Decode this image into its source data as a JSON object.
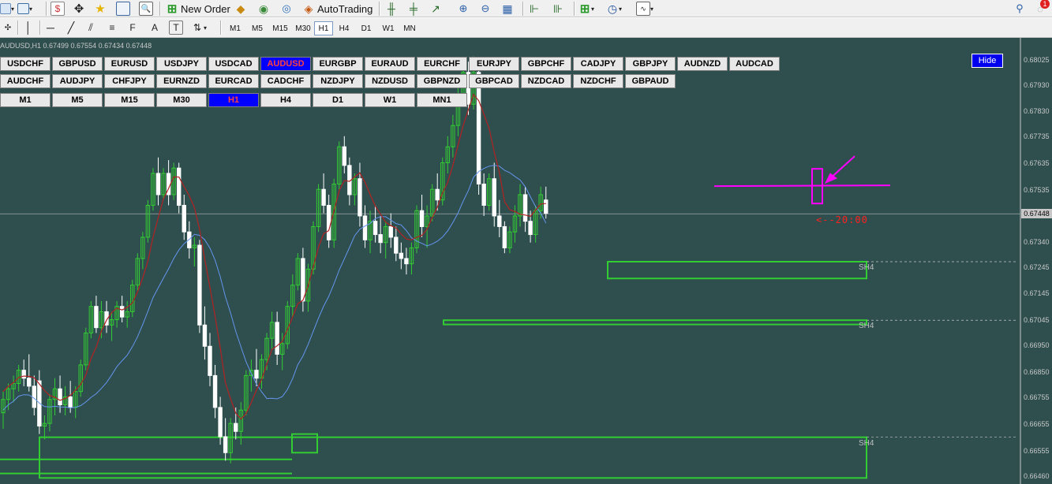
{
  "toolbar": {
    "new_order_label": "New Order",
    "autotrading_label": "AutoTrading",
    "timeframes": [
      "M1",
      "M5",
      "M15",
      "M30",
      "H1",
      "H4",
      "D1",
      "W1",
      "MN"
    ],
    "active_timeframe": "H1",
    "notification_count": "1"
  },
  "chart": {
    "title": "AUDUSD,H1  0.67499 0.67554 0.67434 0.67448",
    "current_price": "0.67448",
    "price_labels": [
      "0.68025",
      "0.67930",
      "0.67830",
      "0.67735",
      "0.67635",
      "0.67535",
      "0.67440",
      "0.67340",
      "0.67245",
      "0.67145",
      "0.67045",
      "0.66950",
      "0.66850",
      "0.66755",
      "0.66655",
      "0.66555",
      "0.66460"
    ],
    "annotation": "<--20:00",
    "zone_labels": [
      "SH4",
      "SH4",
      "SH4"
    ],
    "colors": {
      "background": "#2f4f4f",
      "bull_candle": "#32cd32",
      "bear_candle": "#ffffff",
      "ma_red": "#b22222",
      "ma_blue": "#6495ed",
      "zone": "#32cd32",
      "marker": "#ff00ff"
    }
  },
  "symbols": {
    "row1": [
      "USDCHF",
      "GBPUSD",
      "EURUSD",
      "USDJPY",
      "USDCAD",
      "AUDUSD",
      "EURGBP",
      "EURAUD",
      "EURCHF",
      "EURJPY",
      "GBPCHF",
      "CADJPY",
      "GBPJPY",
      "AUDNZD",
      "AUDCAD"
    ],
    "row2": [
      "AUDCHF",
      "AUDJPY",
      "CHFJPY",
      "EURNZD",
      "EURCAD",
      "CADCHF",
      "NZDJPY",
      "NZDUSD",
      "GBPNZD",
      "GBPCAD",
      "NZDCAD",
      "NZDCHF",
      "GBPAUD"
    ],
    "row3": [
      "M1",
      "M5",
      "M15",
      "M30",
      "H1",
      "H4",
      "D1",
      "W1",
      "MN1"
    ],
    "active_symbol": "AUDUSD",
    "active_tf": "H1"
  },
  "hide_label": "Hide",
  "chart_data": {
    "type": "candlestick",
    "symbol": "AUDUSD",
    "timeframe": "H1",
    "ylim": [
      0.6645,
      0.6808
    ],
    "candles": [
      [
        0.667,
        0.6678,
        0.6664,
        0.6675
      ],
      [
        0.6675,
        0.6681,
        0.6671,
        0.6679
      ],
      [
        0.6679,
        0.6684,
        0.6674,
        0.6681
      ],
      [
        0.6681,
        0.6688,
        0.6678,
        0.6686
      ],
      [
        0.6686,
        0.669,
        0.668,
        0.6683
      ],
      [
        0.6683,
        0.6692,
        0.6678,
        0.668
      ],
      [
        0.668,
        0.6684,
        0.6669,
        0.6672
      ],
      [
        0.6682,
        0.6686,
        0.6662,
        0.6665
      ],
      [
        0.6665,
        0.6669,
        0.666,
        0.6666
      ],
      [
        0.6666,
        0.6677,
        0.6663,
        0.6675
      ],
      [
        0.6675,
        0.6683,
        0.6669,
        0.6679
      ],
      [
        0.6679,
        0.6684,
        0.667,
        0.6673
      ],
      [
        0.6673,
        0.668,
        0.6669,
        0.6676
      ],
      [
        0.6676,
        0.6682,
        0.667,
        0.6672
      ],
      [
        0.6672,
        0.668,
        0.6668,
        0.6678
      ],
      [
        0.6678,
        0.669,
        0.6676,
        0.6688
      ],
      [
        0.6688,
        0.6702,
        0.6686,
        0.67
      ],
      [
        0.67,
        0.6712,
        0.6698,
        0.671
      ],
      [
        0.671,
        0.6714,
        0.67,
        0.6702
      ],
      [
        0.6702,
        0.6712,
        0.6698,
        0.6708
      ],
      [
        0.6708,
        0.6712,
        0.67,
        0.6703
      ],
      [
        0.6703,
        0.6708,
        0.6697,
        0.6705
      ],
      [
        0.6705,
        0.6712,
        0.6702,
        0.671
      ],
      [
        0.671,
        0.6714,
        0.6704,
        0.6706
      ],
      [
        0.6706,
        0.6712,
        0.6702,
        0.6708
      ],
      [
        0.6708,
        0.672,
        0.6706,
        0.6718
      ],
      [
        0.6718,
        0.673,
        0.6716,
        0.6728
      ],
      [
        0.6728,
        0.6738,
        0.6724,
        0.6736
      ],
      [
        0.6736,
        0.675,
        0.6734,
        0.6748
      ],
      [
        0.6748,
        0.6762,
        0.6746,
        0.676
      ],
      [
        0.676,
        0.6766,
        0.6748,
        0.6752
      ],
      [
        0.6752,
        0.6762,
        0.675,
        0.676
      ],
      [
        0.676,
        0.6765,
        0.6748,
        0.6752
      ],
      [
        0.6752,
        0.6764,
        0.675,
        0.6762
      ],
      [
        0.6762,
        0.6764,
        0.6745,
        0.6748
      ],
      [
        0.6748,
        0.6752,
        0.6735,
        0.6738
      ],
      [
        0.6738,
        0.6742,
        0.6728,
        0.6732
      ],
      [
        0.6732,
        0.6736,
        0.6725,
        0.6733
      ],
      [
        0.6733,
        0.6735,
        0.67,
        0.6703
      ],
      [
        0.6703,
        0.671,
        0.669,
        0.6695
      ],
      [
        0.6695,
        0.67,
        0.668,
        0.6684
      ],
      [
        0.6684,
        0.6688,
        0.6668,
        0.6672
      ],
      [
        0.6672,
        0.6676,
        0.6658,
        0.6661
      ],
      [
        0.6661,
        0.6668,
        0.6652,
        0.6655
      ],
      [
        0.6655,
        0.6668,
        0.6651,
        0.6666
      ],
      [
        0.6666,
        0.6672,
        0.666,
        0.6663
      ],
      [
        0.6663,
        0.6674,
        0.6658,
        0.6671
      ],
      [
        0.6671,
        0.6686,
        0.6669,
        0.6684
      ],
      [
        0.6684,
        0.669,
        0.6678,
        0.6686
      ],
      [
        0.6686,
        0.6694,
        0.668,
        0.6683
      ],
      [
        0.6683,
        0.6692,
        0.6679,
        0.669
      ],
      [
        0.669,
        0.67,
        0.6686,
        0.6698
      ],
      [
        0.6698,
        0.6708,
        0.6694,
        0.6704
      ],
      [
        0.6704,
        0.6708,
        0.6688,
        0.6692
      ],
      [
        0.6692,
        0.67,
        0.6686,
        0.6696
      ],
      [
        0.6696,
        0.6712,
        0.6694,
        0.671
      ],
      [
        0.671,
        0.6722,
        0.6706,
        0.6718
      ],
      [
        0.6718,
        0.673,
        0.6716,
        0.6728
      ],
      [
        0.6728,
        0.6732,
        0.6708,
        0.6712
      ],
      [
        0.6712,
        0.6726,
        0.6708,
        0.6724
      ],
      [
        0.6724,
        0.6742,
        0.6722,
        0.674
      ],
      [
        0.674,
        0.6756,
        0.6738,
        0.6754
      ],
      [
        0.6754,
        0.676,
        0.6745,
        0.6748
      ],
      [
        0.6748,
        0.6752,
        0.6732,
        0.6735
      ],
      [
        0.6735,
        0.6758,
        0.6732,
        0.6756
      ],
      [
        0.6756,
        0.6772,
        0.6754,
        0.677
      ],
      [
        0.677,
        0.6774,
        0.676,
        0.6763
      ],
      [
        0.6763,
        0.6766,
        0.6748,
        0.6752
      ],
      [
        0.6752,
        0.676,
        0.6748,
        0.6758
      ],
      [
        0.6758,
        0.6764,
        0.674,
        0.6744
      ],
      [
        0.6744,
        0.6748,
        0.6732,
        0.6735
      ],
      [
        0.6735,
        0.6746,
        0.673,
        0.6742
      ],
      [
        0.6742,
        0.6748,
        0.6734,
        0.6737
      ],
      [
        0.6737,
        0.6744,
        0.673,
        0.6734
      ],
      [
        0.6734,
        0.6742,
        0.6728,
        0.674
      ],
      [
        0.674,
        0.6745,
        0.6732,
        0.6736
      ],
      [
        0.6736,
        0.674,
        0.6727,
        0.673
      ],
      [
        0.673,
        0.6734,
        0.6724,
        0.6728
      ],
      [
        0.6728,
        0.6732,
        0.6722,
        0.6726
      ],
      [
        0.6726,
        0.6734,
        0.6722,
        0.6732
      ],
      [
        0.6732,
        0.6748,
        0.673,
        0.6746
      ],
      [
        0.6746,
        0.6752,
        0.6736,
        0.674
      ],
      [
        0.674,
        0.6748,
        0.6732,
        0.6744
      ],
      [
        0.6744,
        0.6756,
        0.6742,
        0.6754
      ],
      [
        0.6754,
        0.676,
        0.6746,
        0.675
      ],
      [
        0.675,
        0.6766,
        0.6748,
        0.6764
      ],
      [
        0.6764,
        0.6774,
        0.676,
        0.677
      ],
      [
        0.677,
        0.6782,
        0.6766,
        0.6778
      ],
      [
        0.6778,
        0.6792,
        0.6774,
        0.679
      ],
      [
        0.679,
        0.6802,
        0.6786,
        0.6798
      ],
      [
        0.6798,
        0.6802,
        0.6782,
        0.6786
      ],
      [
        0.6786,
        0.6804,
        0.6784,
        0.6798
      ],
      [
        0.6798,
        0.68,
        0.6752,
        0.6756
      ],
      [
        0.6756,
        0.676,
        0.6744,
        0.6748
      ],
      [
        0.6748,
        0.676,
        0.6746,
        0.6758
      ],
      [
        0.6758,
        0.6764,
        0.674,
        0.6744
      ],
      [
        0.6744,
        0.675,
        0.6736,
        0.674
      ],
      [
        0.674,
        0.6742,
        0.673,
        0.6732
      ],
      [
        0.6732,
        0.674,
        0.673,
        0.6738
      ],
      [
        0.6738,
        0.6748,
        0.6734,
        0.6744
      ],
      [
        0.6744,
        0.6756,
        0.674,
        0.6752
      ],
      [
        0.6752,
        0.6755,
        0.6738,
        0.6742
      ],
      [
        0.6742,
        0.6746,
        0.6734,
        0.6737
      ],
      [
        0.6737,
        0.6748,
        0.6734,
        0.6746
      ],
      [
        0.6746,
        0.6755,
        0.6743,
        0.6752
      ],
      [
        0.675,
        0.6755,
        0.6743,
        0.6745
      ]
    ],
    "zones": [
      {
        "label": "SH4",
        "top": 0.67268,
        "bottom": 0.67205
      },
      {
        "label": "SH4",
        "top": 0.67048,
        "bottom": 0.67032
      },
      {
        "label": "SH4",
        "top": 0.66608,
        "bottom": 0.66455
      }
    ],
    "marker_line_price": 0.67552
  }
}
